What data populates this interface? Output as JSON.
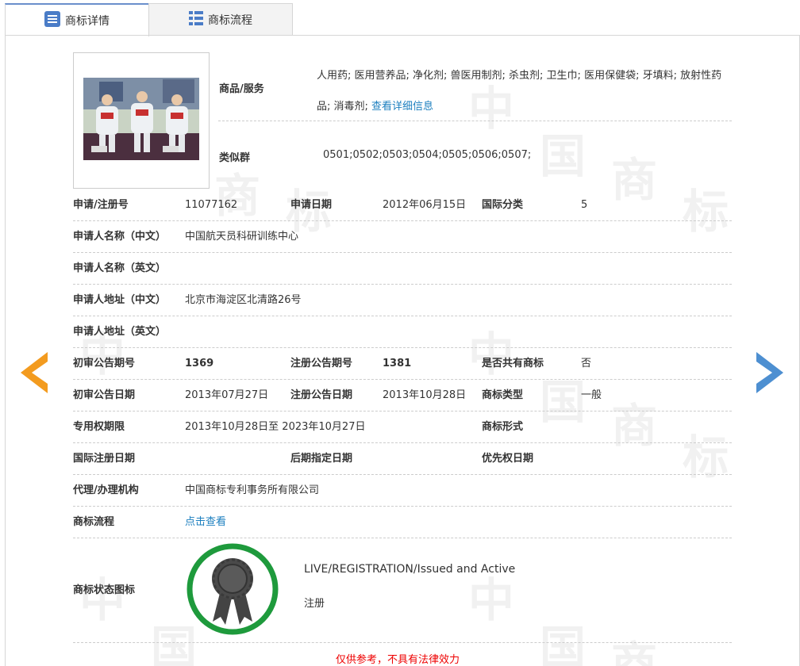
{
  "tabs": [
    {
      "label": "商标详情",
      "active": true,
      "icon": "list-icon"
    },
    {
      "label": "商标流程",
      "active": false,
      "icon": "grid-icon"
    }
  ],
  "watermark_chars": [
    "中",
    "国",
    "商",
    "标"
  ],
  "goods": {
    "label": "商品/服务",
    "text": "人用药; 医用营养品; 净化剂; 兽医用制剂; 杀虫剂; 卫生巾; 医用保健袋; 牙填料; 放射性药品; 消毒剂;",
    "link": "查看详细信息"
  },
  "similar": {
    "label": "类似群",
    "value": "0501;0502;0503;0504;0505;0506;0507;"
  },
  "rows": {
    "reg_no_label": "申请/注册号",
    "reg_no": "11077162",
    "apply_date_label": "申请日期",
    "apply_date": "2012年06月15日",
    "intl_class_label": "国际分类",
    "intl_class": "5",
    "applicant_cn_label": "申请人名称（中文）",
    "applicant_cn": "中国航天员科研训练中心",
    "applicant_en_label": "申请人名称（英文）",
    "applicant_en": "",
    "address_cn_label": "申请人地址（中文）",
    "address_cn": "北京市海淀区北清路26号",
    "address_en_label": "申请人地址（英文）",
    "address_en": "",
    "prelim_issue_label": "初审公告期号",
    "prelim_issue": "1369",
    "reg_issue_label": "注册公告期号",
    "reg_issue": "1381",
    "shared_label": "是否共有商标",
    "shared": "否",
    "prelim_date_label": "初审公告日期",
    "prelim_date": "2013年07月27日",
    "reg_date_label": "注册公告日期",
    "reg_date": "2013年10月28日",
    "tm_type_label": "商标类型",
    "tm_type": "一般",
    "exclusive_label": "专用权期限",
    "exclusive": "2013年10月28日至 2023年10月27日",
    "tm_form_label": "商标形式",
    "tm_form": "",
    "intl_reg_date_label": "国际注册日期",
    "intl_reg_date": "",
    "later_date_label": "后期指定日期",
    "later_date": "",
    "priority_date_label": "优先权日期",
    "priority_date": "",
    "agent_label": "代理/办理机构",
    "agent": "中国商标专利事务所有限公司",
    "flow_label": "商标流程",
    "flow_link": "点击查看"
  },
  "status": {
    "label": "商标状态图标",
    "en": "LIVE/REGISTRATION/Issued and Active",
    "cn": "注册",
    "ring_color": "#1e9a3c"
  },
  "disclaimer": "仅供参考，不具有法律效力",
  "colors": {
    "arrow_left": "#f39b1f",
    "arrow_right": "#4d8fd1",
    "link": "#1c7fbf",
    "disclaimer": "#e00000"
  }
}
